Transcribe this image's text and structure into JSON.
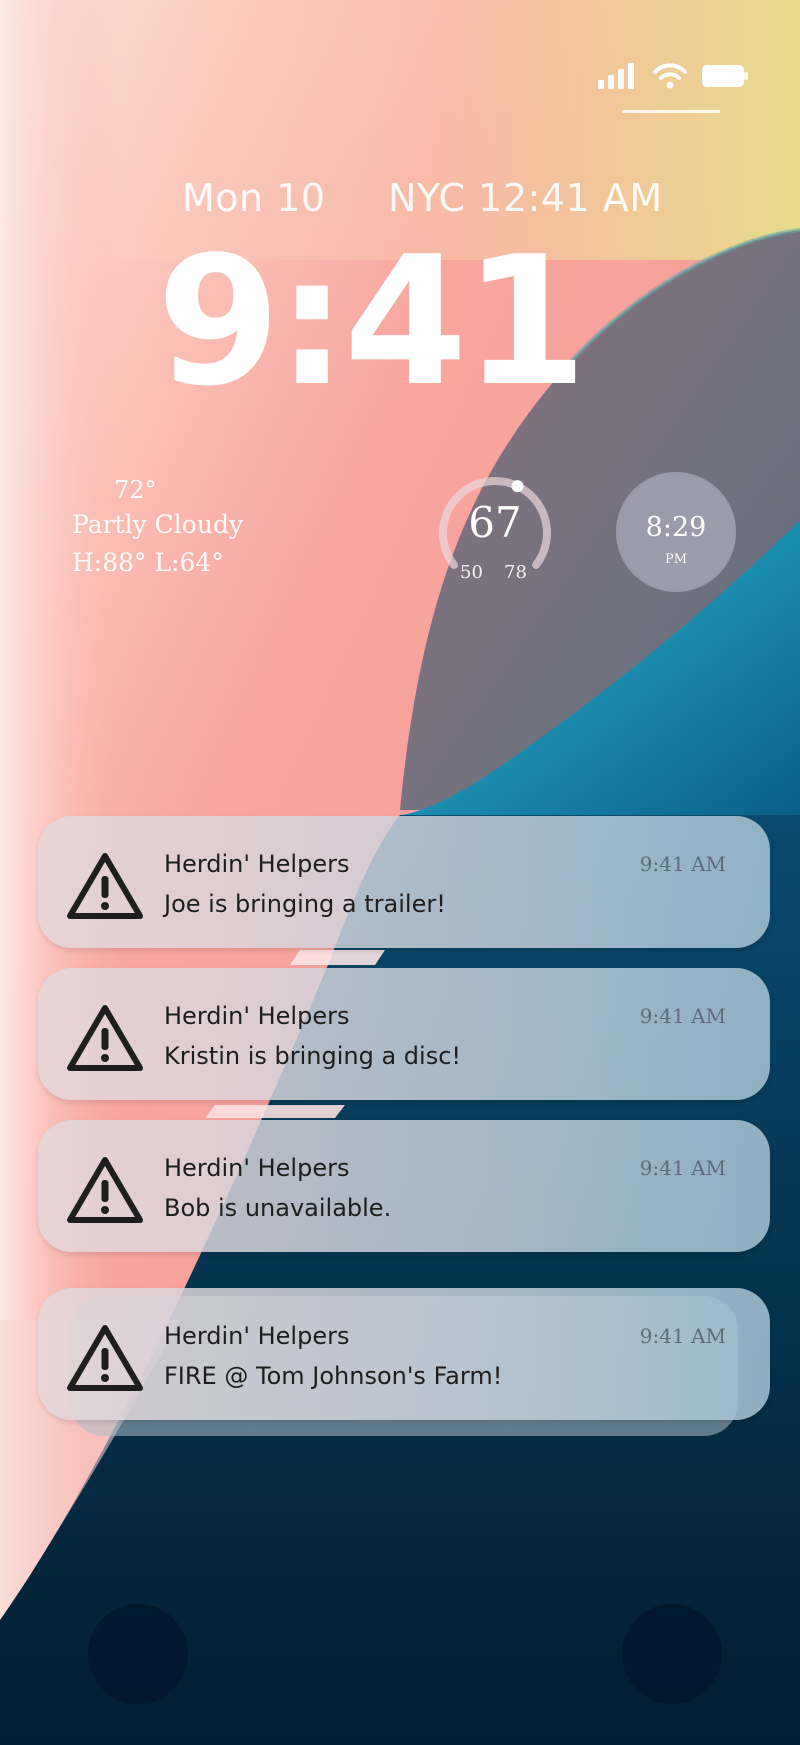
{
  "colors": {
    "pink": "#f6a1a0",
    "navy": "#06324f",
    "teal": "#1c92b4",
    "notification_text": "#1e1e1e",
    "notification_time": "#5c6b77"
  },
  "status_bar": {
    "icons": [
      "cellular-signal-icon",
      "wifi-icon",
      "battery-icon"
    ]
  },
  "lock_screen": {
    "date": "Mon 10",
    "world_clock": "NYC 12:41 AM",
    "time": "9:41"
  },
  "widgets": {
    "weather": {
      "temp": "72°",
      "condition": "Partly Cloudy",
      "high_low": "H:88° L:64°"
    },
    "temperature_gauge": {
      "value": "67",
      "min": "50",
      "max": "78",
      "level": 0.6
    },
    "clock": {
      "time": "8:29",
      "ampm": "PM"
    }
  },
  "notifications": [
    {
      "app": "Herdin' Helpers",
      "message": "Joe is bringing a trailer!",
      "time": "9:41 AM",
      "icon": "warning-icon"
    },
    {
      "app": "Herdin' Helpers",
      "message": "Kristin is bringing a disc!",
      "time": "9:41 AM",
      "icon": "warning-icon"
    },
    {
      "app": "Herdin' Helpers",
      "message": "Bob is unavailable.",
      "time": "9:41 AM",
      "icon": "warning-icon"
    },
    {
      "app": "Herdin' Helpers",
      "message": "FIRE @ Tom Johnson's Farm!",
      "time": "9:41 AM",
      "icon": "warning-icon"
    }
  ]
}
